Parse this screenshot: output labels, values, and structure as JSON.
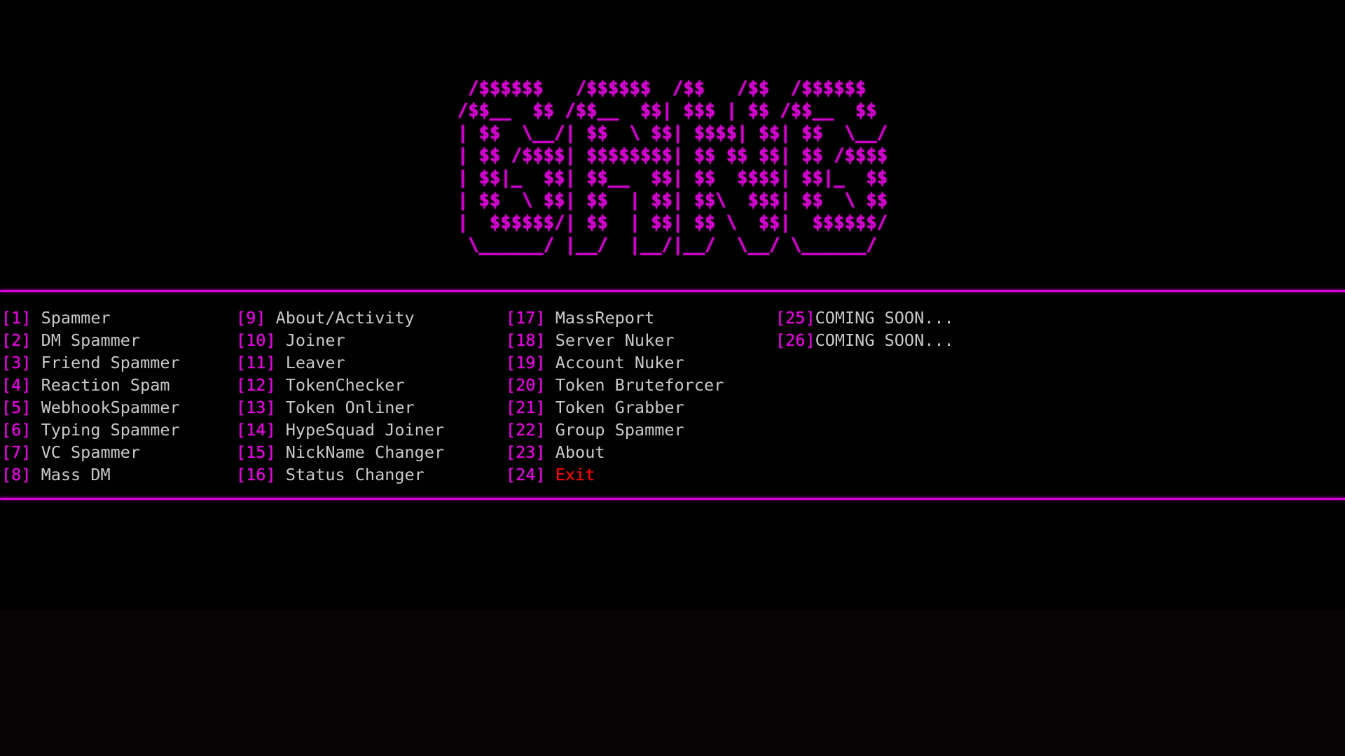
{
  "window": {
    "title": "GANG",
    "background_color": "#000000"
  },
  "colors": {
    "accent_magenta": "#d400d4",
    "key_magenta": "#e000e0",
    "label_gray": "#c9c9c9",
    "danger_red": "#ee0000"
  },
  "banner": {
    "name": "GANG",
    "font_style": "big-money-ne",
    "color": "#d600d6",
    "ascii": " /$$$$$$   /$$$$$$  /$$   /$$  /$$$$$$ \n/$$__  $$ /$$__  $$| $$$ | $$ /$$__  $$\n| $$  \\__/| $$  \\ $$| $$$$| $$| $$  \\__/\n| $$ /$$$$| $$$$$$$$| $$ $$ $$| $$ /$$$$\n| $$|_  $$| $$__  $$| $$  $$$$| $$|_  $$\n| $$  \\ $$| $$  | $$| $$\\  $$$| $$  \\ $$\n|  $$$$$$/| $$  | $$| $$ \\  $$|  $$$$$$/\n \\______/ |__/  |__/|__/  \\__/ \\______/ "
  },
  "divider_top": "horizontal-rule",
  "divider_bottom": "horizontal-rule",
  "menu": {
    "columns": [
      {
        "name": "column-1",
        "items": [
          {
            "key": "[1] ",
            "label": "Spammer",
            "style": "normal"
          },
          {
            "key": "[2] ",
            "label": "DM Spammer",
            "style": "normal"
          },
          {
            "key": "[3] ",
            "label": "Friend Spammer",
            "style": "normal"
          },
          {
            "key": "[4] ",
            "label": "Reaction Spam",
            "style": "normal"
          },
          {
            "key": "[5] ",
            "label": "WebhookSpammer",
            "style": "normal"
          },
          {
            "key": "[6] ",
            "label": "Typing Spammer",
            "style": "normal"
          },
          {
            "key": "[7] ",
            "label": "VC Spammer",
            "style": "normal"
          },
          {
            "key": "[8] ",
            "label": "Mass DM",
            "style": "normal"
          }
        ]
      },
      {
        "name": "column-2",
        "items": [
          {
            "key": "[9] ",
            "label": "About/Activity",
            "style": "normal"
          },
          {
            "key": "[10] ",
            "label": "Joiner",
            "style": "normal"
          },
          {
            "key": "[11] ",
            "label": "Leaver",
            "style": "normal"
          },
          {
            "key": "[12] ",
            "label": "TokenChecker",
            "style": "normal"
          },
          {
            "key": "[13] ",
            "label": "Token Onliner",
            "style": "normal"
          },
          {
            "key": "[14] ",
            "label": "HypeSquad Joiner",
            "style": "normal"
          },
          {
            "key": "[15] ",
            "label": "NickName Changer",
            "style": "normal"
          },
          {
            "key": "[16] ",
            "label": "Status Changer",
            "style": "normal"
          }
        ]
      },
      {
        "name": "column-3",
        "items": [
          {
            "key": "[17] ",
            "label": "MassReport",
            "style": "normal"
          },
          {
            "key": "[18] ",
            "label": "Server Nuker",
            "style": "normal"
          },
          {
            "key": "[19] ",
            "label": "Account Nuker",
            "style": "normal"
          },
          {
            "key": "[20] ",
            "label": "Token Bruteforcer",
            "style": "normal"
          },
          {
            "key": "[21] ",
            "label": "Token Grabber",
            "style": "normal"
          },
          {
            "key": "[22] ",
            "label": "Group Spammer",
            "style": "normal"
          },
          {
            "key": "[23] ",
            "label": "About",
            "style": "normal"
          },
          {
            "key": "[24] ",
            "label": "Exit",
            "style": "danger"
          }
        ]
      },
      {
        "name": "column-4",
        "items": [
          {
            "key": "[25]",
            "label": "COMING SOON...",
            "style": "normal"
          },
          {
            "key": "[26]",
            "label": "COMING SOON...",
            "style": "normal"
          }
        ]
      }
    ]
  }
}
